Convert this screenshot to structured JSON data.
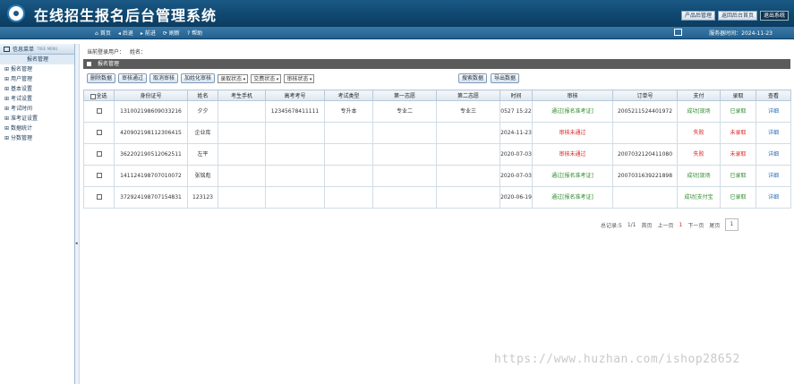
{
  "header": {
    "title": "在线招生报名后台管理系统",
    "actions": [
      "产品后管理",
      "返回后台首页",
      "退出系统"
    ]
  },
  "nav": {
    "links": [
      {
        "icon": "home-icon",
        "label": "首页"
      },
      {
        "icon": "back-icon",
        "label": "后退"
      },
      {
        "icon": "forward-icon",
        "label": "前进"
      },
      {
        "icon": "refresh-icon",
        "label": "刷新"
      },
      {
        "icon": "help-icon",
        "label": "帮助"
      }
    ],
    "date_label": "服务器时间：2024-11-23"
  },
  "sidebar": {
    "header": "信息菜单",
    "header_small": "TREE MENU",
    "items": [
      "报名管理",
      "报名管理",
      "用户管理",
      "基本设置",
      "考试设置",
      "考试时间",
      "准考证设置",
      "数据统计",
      "分数管理"
    ]
  },
  "main": {
    "user_label": "当前登录用户：",
    "user_name": "姓名：",
    "section_title": "报名管理",
    "toolbar": {
      "delete": "删除数据",
      "approve": "审核通过",
      "cancel": "取消审核",
      "batch": "加姓化审核",
      "select1": "录取状态",
      "select2": "交费状态",
      "select3": "审核状态",
      "search": "搜索数据",
      "export": "导出数据"
    },
    "columns": [
      "全选",
      "身份证号",
      "姓名",
      "考生手机",
      "高考考号",
      "考试类型",
      "第一志愿",
      "第二志愿",
      "时间",
      "审核",
      "订单号",
      "支付",
      "录取",
      "查看"
    ],
    "rows": [
      {
        "id": "131002198609033216",
        "name": "夕夕",
        "phone": "",
        "exam_no": "12345678411111",
        "type": "专升本",
        "first": "专业二",
        "second": "专业三",
        "time": "0527 15:22",
        "review": "通过[报名准考证]",
        "review_color": "green",
        "order": "2005211524401972",
        "pay": "成功[现场",
        "pay_color": "green",
        "admit": "已录取",
        "admit_color": "green",
        "view": "详细"
      },
      {
        "id": "420902198112306415",
        "name": "企业库",
        "phone": "",
        "exam_no": "",
        "type": "",
        "first": "",
        "second": "",
        "time": "2024-11-23",
        "review": "审核未通过",
        "review_color": "red",
        "order": "",
        "pay": "失败",
        "pay_color": "red",
        "admit": "未录取",
        "admit_color": "red",
        "view": "详细"
      },
      {
        "id": "362202190512062511",
        "name": "左平",
        "phone": "",
        "exam_no": "",
        "type": "",
        "first": "",
        "second": "",
        "time": "2020-07-03",
        "review": "审核未通过",
        "review_color": "red",
        "order": "2007032120411080",
        "pay": "失败",
        "pay_color": "red",
        "admit": "未录取",
        "admit_color": "red",
        "view": "详细"
      },
      {
        "id": "141124198707010072",
        "name": "张铭彪",
        "phone": "",
        "exam_no": "",
        "type": "",
        "first": "",
        "second": "",
        "time": "2020-07-03",
        "review": "通过[报名准考证]",
        "review_color": "green",
        "order": "2007031639221898",
        "pay": "成功[现场",
        "pay_color": "green",
        "admit": "已录取",
        "admit_color": "green",
        "view": "详细"
      },
      {
        "id": "372924198707154831",
        "name": "123123",
        "phone": "",
        "exam_no": "",
        "type": "",
        "first": "",
        "second": "",
        "time": "2020-06-19",
        "review": "通过[报名准考证]",
        "review_color": "green",
        "order": "",
        "pay": "成功[支付宝",
        "pay_color": "green",
        "admit": "已录取",
        "admit_color": "green",
        "view": "详细"
      }
    ],
    "pager": {
      "total": "总记录:5",
      "pages": "1/1",
      "first": "首页",
      "prev": "上一页",
      "current": "1",
      "next": "下一页",
      "last": "尾页",
      "goto": "1"
    }
  },
  "watermark": "https://www.huzhan.com/ishop28652"
}
